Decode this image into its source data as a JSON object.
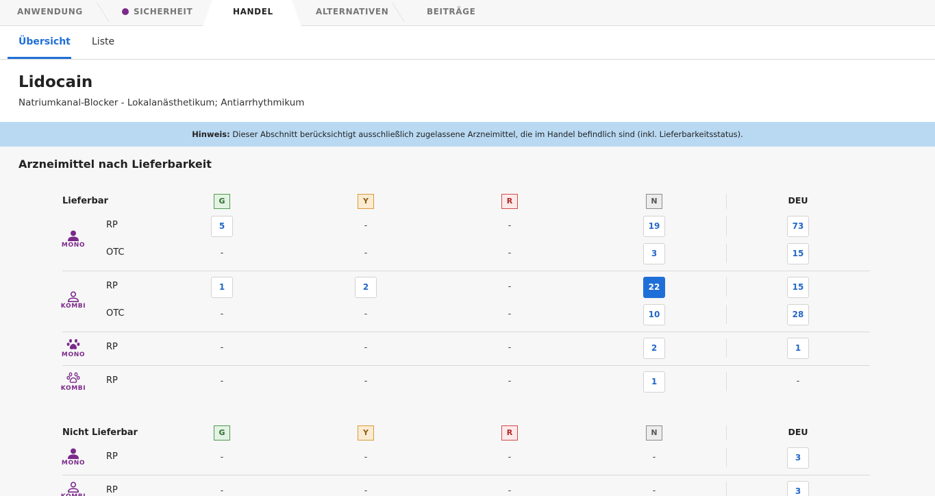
{
  "colors": {
    "accent": "#1f6fd8",
    "purple": "#7a2a8a",
    "notice_bg": "#b9d9f2",
    "status_dot_sicherheit": "#7a2a8a"
  },
  "top_tabs": [
    {
      "label": "ANWENDUNG",
      "active": false
    },
    {
      "label": "SICHERHEIT",
      "active": false,
      "dot": true
    },
    {
      "label": "HANDEL",
      "active": true
    },
    {
      "label": "ALTERNATIVEN",
      "active": false
    },
    {
      "label": "BEITRÄGE",
      "active": false
    }
  ],
  "sub_tabs": [
    {
      "label": "Übersicht",
      "active": true
    },
    {
      "label": "Liste",
      "active": false
    }
  ],
  "header": {
    "title": "Lidocain",
    "subtitle": "Natriumkanal-Blocker - Lokalanästhetikum; Antiarrhythmikum"
  },
  "notice": {
    "bold": "Hinweis:",
    "text": " Dieser Abschnitt berücksichtigt ausschließlich zugelassene Arzneimittel, die im Handel befindlich sind (inkl. Lieferbarkeitsstatus)."
  },
  "section_title": "Arzneimittel nach Lieferbarkeit",
  "table": {
    "status_columns": [
      "G",
      "Y",
      "R",
      "N"
    ],
    "total_column": "DEU",
    "groups": [
      {
        "label": "Lieferbar",
        "blocks": [
          {
            "kind": "person-icon",
            "kind_label": "MONO",
            "rows": [
              {
                "type": "RP",
                "G": "5",
                "Y": "-",
                "R": "-",
                "N": "19",
                "DEU": "73"
              },
              {
                "type": "OTC",
                "G": "-",
                "Y": "-",
                "R": "-",
                "N": "3",
                "DEU": "15"
              }
            ]
          },
          {
            "kind": "person-outline-icon",
            "kind_label": "KOMBI",
            "rows": [
              {
                "type": "RP",
                "G": "1",
                "Y": "2",
                "R": "-",
                "N": "22",
                "DEU": "15",
                "selected": "N"
              },
              {
                "type": "OTC",
                "G": "-",
                "Y": "-",
                "R": "-",
                "N": "10",
                "DEU": "28"
              }
            ]
          },
          {
            "kind": "paw-icon",
            "kind_label": "MONO",
            "rows": [
              {
                "type": "RP",
                "G": "-",
                "Y": "-",
                "R": "-",
                "N": "2",
                "DEU": "1"
              }
            ]
          },
          {
            "kind": "paw-outline-icon",
            "kind_label": "KOMBI",
            "rows": [
              {
                "type": "RP",
                "G": "-",
                "Y": "-",
                "R": "-",
                "N": "1",
                "DEU": "-"
              }
            ]
          }
        ]
      },
      {
        "label": "Nicht Lieferbar",
        "blocks": [
          {
            "kind": "person-icon",
            "kind_label": "MONO",
            "rows": [
              {
                "type": "RP",
                "G": "-",
                "Y": "-",
                "R": "-",
                "N": "-",
                "DEU": "3"
              }
            ]
          },
          {
            "kind": "person-outline-icon",
            "kind_label": "KOMBI",
            "rows": [
              {
                "type": "RP",
                "G": "-",
                "Y": "-",
                "R": "-",
                "N": "-",
                "DEU": "3"
              }
            ]
          }
        ]
      }
    ]
  }
}
